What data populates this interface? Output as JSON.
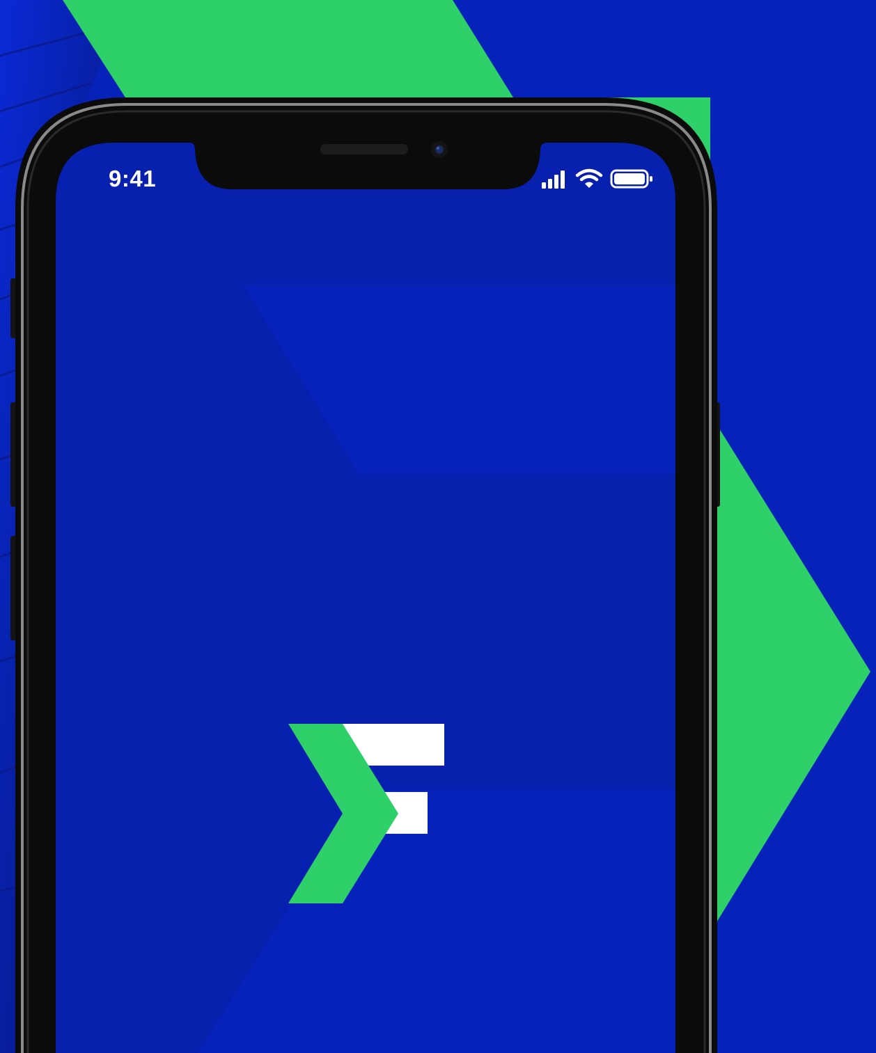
{
  "status_bar": {
    "time": "9:41",
    "icons": [
      "cellular-signal-icon",
      "wifi-icon",
      "battery-icon"
    ]
  },
  "splash": {
    "logo": "app-logo"
  },
  "colors": {
    "brand_blue": "#0622b8",
    "screen_blue": "#0820ae",
    "brand_green": "#2ed06a",
    "logo_white": "#ffffff",
    "phone_frame": "#000000"
  }
}
